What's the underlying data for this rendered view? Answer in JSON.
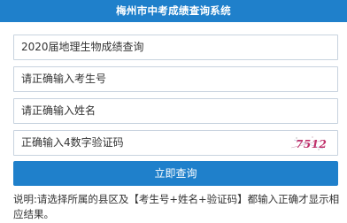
{
  "header": {
    "title": "梅州市中考成绩查询系统"
  },
  "form": {
    "subject_select": "2020届地理生物成绩查询",
    "exam_number_placeholder": "请正确输入考生号",
    "name_placeholder": "请正确输入姓名",
    "captcha_placeholder": "正确输入4数字验证码",
    "captcha_code": "7512"
  },
  "submit": {
    "label": "立即查询"
  },
  "note": {
    "text": "说明:请选择所属的县区及【考生号+姓名+验证码】都输入正确才显示相应结果。"
  },
  "colors": {
    "primary": "#1f80cb",
    "border": "#c8d3df",
    "captcha_text": "#c0306a"
  }
}
